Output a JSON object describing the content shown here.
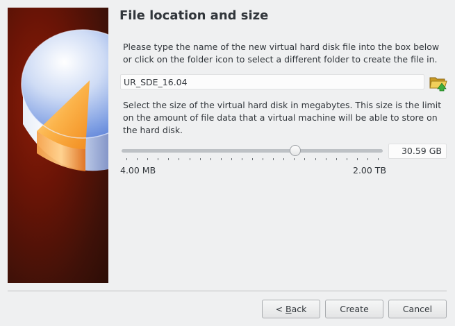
{
  "page": {
    "title": "File location and size"
  },
  "location": {
    "instructions": "Please type the name of the new virtual hard disk file into the box below or click on the folder icon to select a different folder to create the file in.",
    "file_name": "UR_SDE_16.04",
    "folder_icon": "folder-open-icon"
  },
  "size": {
    "instructions": "Select the size of the virtual hard disk in megabytes. This size is the limit on the amount of file data that a virtual machine will be able to store on the hard disk.",
    "value": "30.59 GB",
    "slider_fraction": 0.67,
    "min_label": "4.00 MB",
    "max_label": "2.00 TB",
    "tick_count": 25
  },
  "buttons": {
    "back_prefix": "< ",
    "back_mnemonic": "B",
    "back_rest": "ack",
    "create": "Create",
    "cancel": "Cancel"
  },
  "colors": {
    "window_bg": "#eff0f1",
    "art_bg": "#5a1408",
    "disk_blue": "#6f8fe0",
    "disk_orange": "#f7a535"
  }
}
